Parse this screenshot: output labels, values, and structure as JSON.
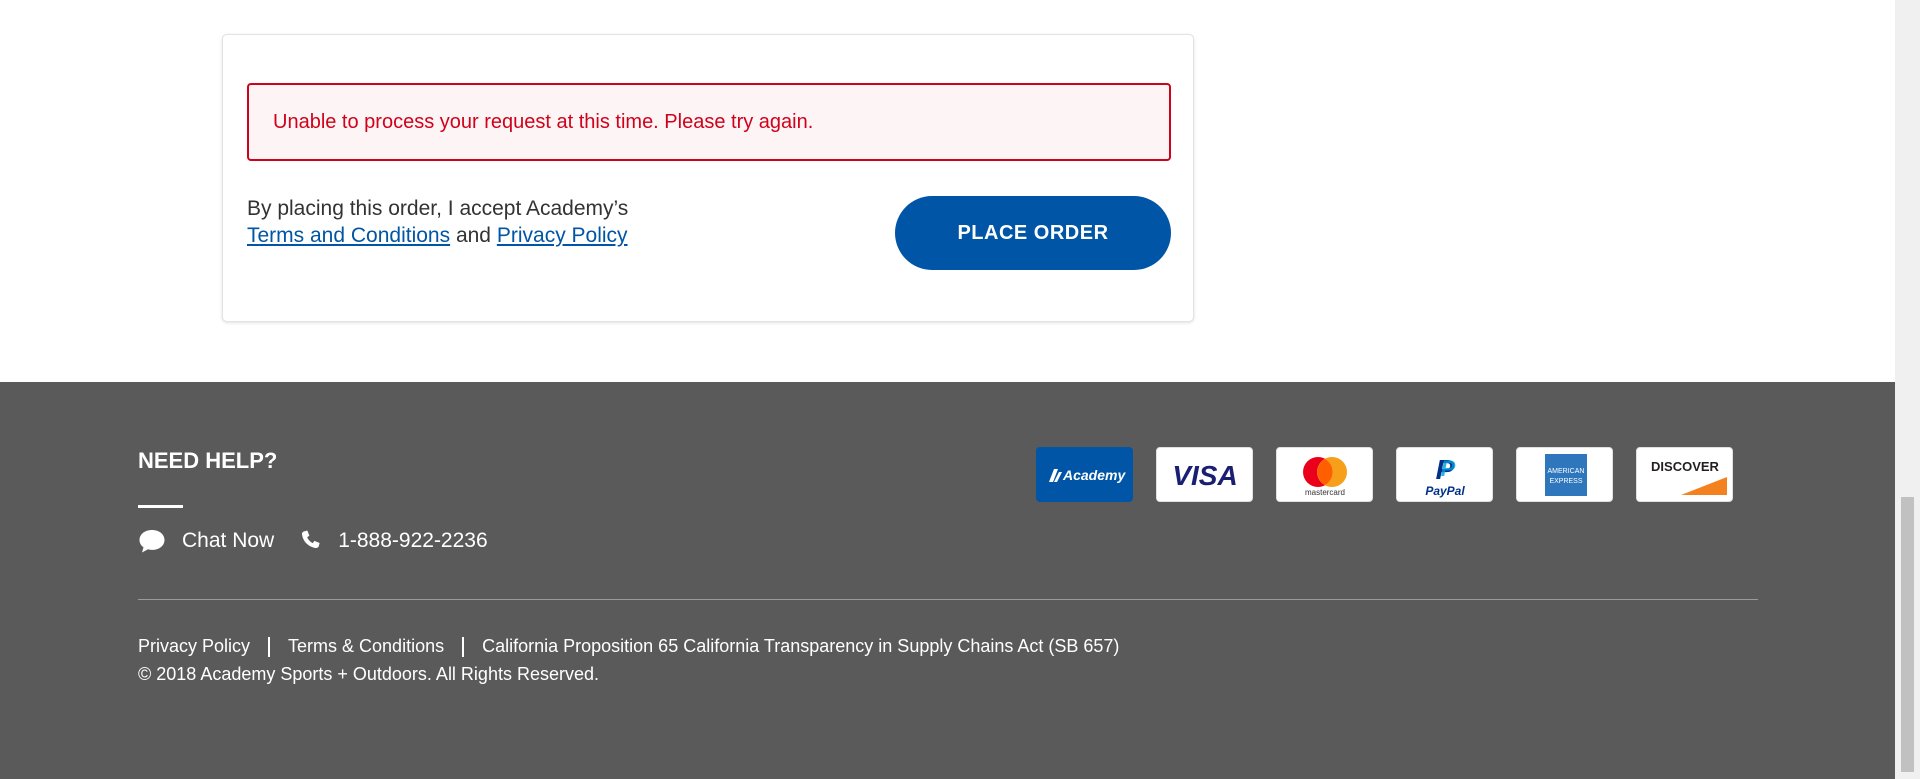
{
  "order": {
    "error_message": "Unable to process your request at this time. Please try again.",
    "accept_prefix": "By placing this order, I accept Academy’s",
    "terms_link": "Terms and Conditions",
    "and_text": "and",
    "privacy_link": "Privacy Policy",
    "place_order_label": "PLACE ORDER"
  },
  "footer": {
    "need_help_title": "NEED HELP?",
    "chat_label": "Chat Now",
    "phone": "1-888-922-2236",
    "payments": [
      {
        "name": "academy-card",
        "label": "Academy"
      },
      {
        "name": "visa",
        "label": "VISA"
      },
      {
        "name": "mastercard",
        "label": "mastercard"
      },
      {
        "name": "paypal",
        "label": "PayPal"
      },
      {
        "name": "american-express",
        "label": "AMERICAN EXPRESS"
      },
      {
        "name": "discover",
        "label": "DISCOVER"
      }
    ],
    "legal_links": {
      "privacy": "Privacy Policy",
      "terms": "Terms & Conditions",
      "prop65": "California Proposition 65 California Transparency in Supply Chains Act (SB 657)"
    },
    "copyright": "© 2018 Academy Sports + Outdoors. All Rights Reserved."
  },
  "colors": {
    "brand_blue": "#0055a6",
    "error_red": "#d0021b",
    "footer_bg": "#5a5a5a"
  }
}
